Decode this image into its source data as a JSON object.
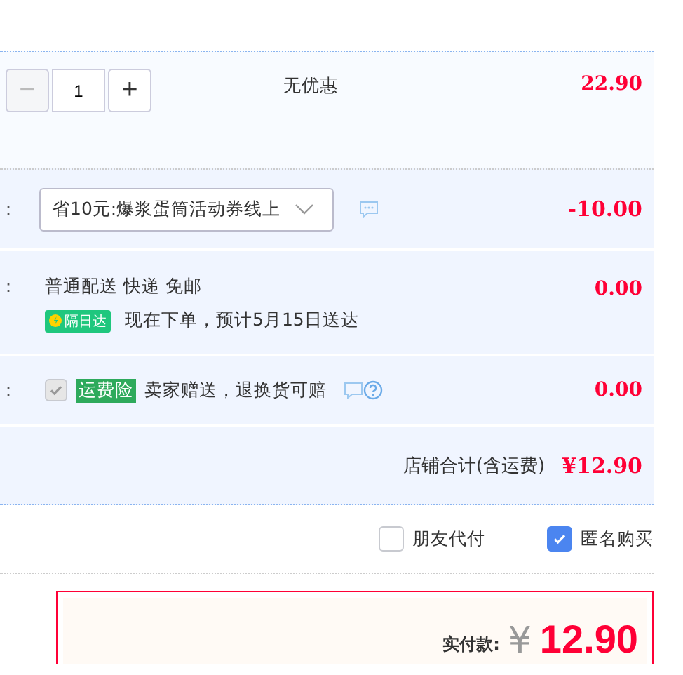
{
  "item_row": {
    "quantity": "1",
    "minus": "−",
    "plus": "+",
    "minus_disabled": true,
    "discount": "无优惠",
    "price": "22.90"
  },
  "coupon_row": {
    "label": "：",
    "selected_coupon": "省10元:爆浆蛋筒活动券线上",
    "amount": "-10.00"
  },
  "delivery_row": {
    "label": "：",
    "method": "普通配送 快递 免邮",
    "badge": "隔日达",
    "eta": "现在下单，预计5月15日送达",
    "amount": "0.00"
  },
  "insurance_row": {
    "label": "：",
    "checked": true,
    "disabled": true,
    "tag": "运费险",
    "description": "卖家赠送，退换货可赔",
    "amount": "0.00"
  },
  "shop_total": {
    "label": "店铺合计(含运费)",
    "amount": "¥12.90"
  },
  "options": [
    {
      "label": "朋友代付",
      "checked": false
    },
    {
      "label": "匿名购买",
      "checked": true
    }
  ],
  "payment": {
    "label": "实付款:",
    "currency": "¥",
    "amount": "12.90"
  }
}
